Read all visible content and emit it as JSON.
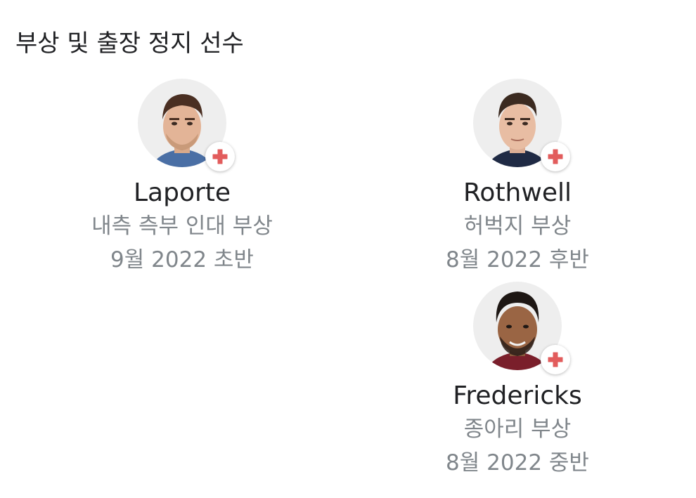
{
  "section": {
    "title": "부상 및 출장 정지 선수"
  },
  "players": [
    {
      "name": "Laporte",
      "injury": "내측 측부 인대 부상",
      "return": "9월 2022 초반",
      "avatar_icon": "player-photo",
      "badge_icon": "red-cross-icon"
    },
    {
      "name": "Rothwell",
      "injury": "허벅지 부상",
      "return": "8월 2022 후반",
      "avatar_icon": "player-photo",
      "badge_icon": "red-cross-icon"
    },
    {
      "name": "Fredericks",
      "injury": "종아리 부상",
      "return": "8월 2022 중반",
      "avatar_icon": "player-photo",
      "badge_icon": "red-cross-icon"
    }
  ],
  "colors": {
    "badge_red": "#e25c5c",
    "secondary_text": "#80868b",
    "primary_text": "#202124",
    "avatar_bg": "#eeeeee"
  }
}
